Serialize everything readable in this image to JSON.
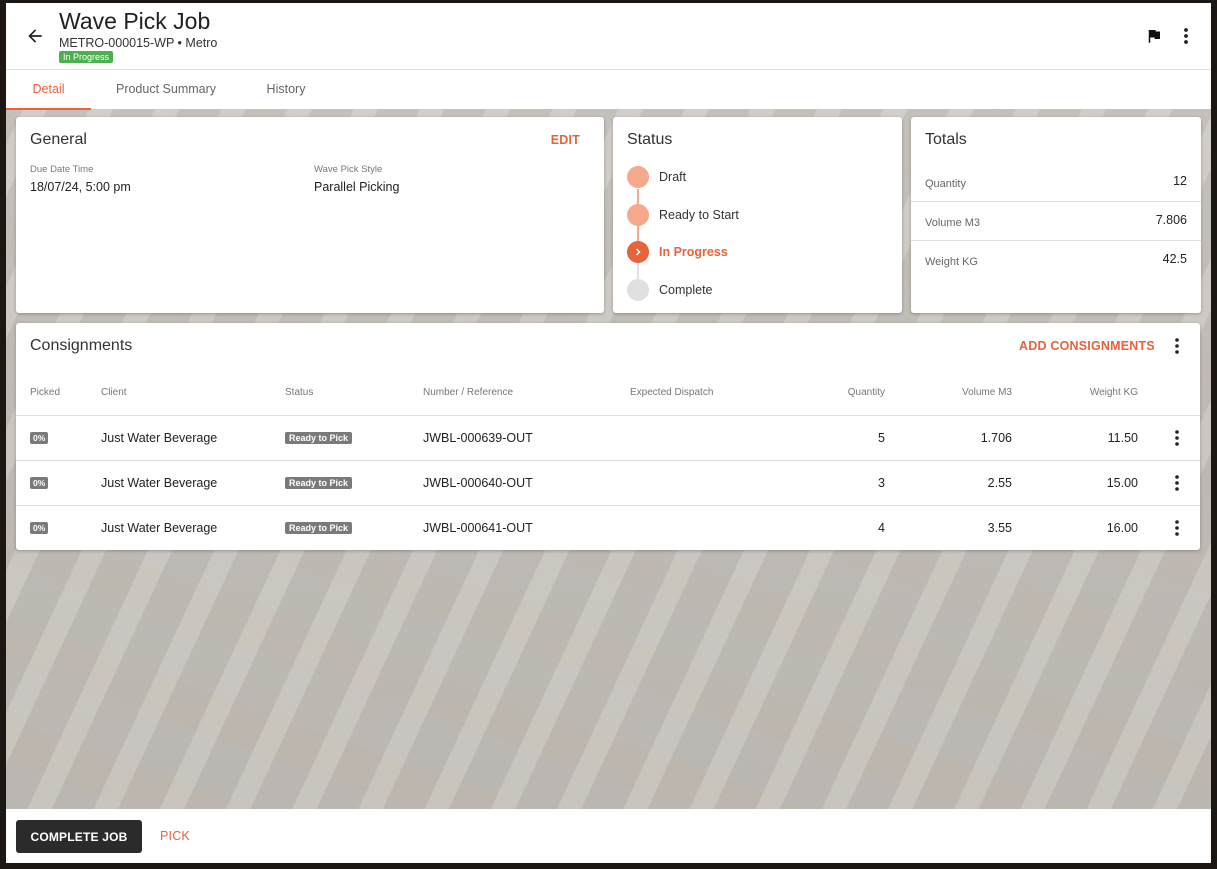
{
  "header": {
    "title": "Wave Pick Job",
    "subtitle": "METRO-000015-WP • Metro",
    "status_badge": "In Progress"
  },
  "tabs": [
    {
      "label": "Detail",
      "active": true
    },
    {
      "label": "Product Summary",
      "active": false
    },
    {
      "label": "History",
      "active": false
    }
  ],
  "general": {
    "title": "General",
    "edit_label": "EDIT",
    "due_label": "Due Date Time",
    "due_value": "18/07/24, 5:00 pm",
    "style_label": "Wave Pick Style",
    "style_value": "Parallel Picking"
  },
  "status": {
    "title": "Status",
    "steps": [
      {
        "label": "Draft",
        "state": "done"
      },
      {
        "label": "Ready to Start",
        "state": "done"
      },
      {
        "label": "In Progress",
        "state": "current"
      },
      {
        "label": "Complete",
        "state": "pending"
      }
    ]
  },
  "totals": {
    "title": "Totals",
    "rows": [
      {
        "label": "Quantity",
        "value": "12"
      },
      {
        "label": "Volume M3",
        "value": "7.806"
      },
      {
        "label": "Weight KG",
        "value": "42.5"
      }
    ]
  },
  "consignments": {
    "title": "Consignments",
    "add_label": "ADD CONSIGNMENTS",
    "columns": {
      "picked": "Picked",
      "client": "Client",
      "status": "Status",
      "number": "Number / Reference",
      "dispatch": "Expected Dispatch",
      "quantity": "Quantity",
      "volume": "Volume M3",
      "weight": "Weight KG"
    },
    "rows": [
      {
        "picked": "0%",
        "client": "Just Water Beverage",
        "status": "Ready to Pick",
        "number": "JWBL-000639-OUT",
        "dispatch": "",
        "quantity": "5",
        "volume": "1.706",
        "weight": "11.50"
      },
      {
        "picked": "0%",
        "client": "Just Water Beverage",
        "status": "Ready to Pick",
        "number": "JWBL-000640-OUT",
        "dispatch": "",
        "quantity": "3",
        "volume": "2.55",
        "weight": "15.00"
      },
      {
        "picked": "0%",
        "client": "Just Water Beverage",
        "status": "Ready to Pick",
        "number": "JWBL-000641-OUT",
        "dispatch": "",
        "quantity": "4",
        "volume": "3.55",
        "weight": "16.00"
      }
    ]
  },
  "footer": {
    "complete_label": "COMPLETE JOB",
    "pick_label": "PICK"
  },
  "colors": {
    "accent": "#e8623a",
    "accent_light": "#f6a88a",
    "in_progress_badge": "#4caf50",
    "pending": "#e0e0e0",
    "dark_button": "#2b2b2b"
  }
}
